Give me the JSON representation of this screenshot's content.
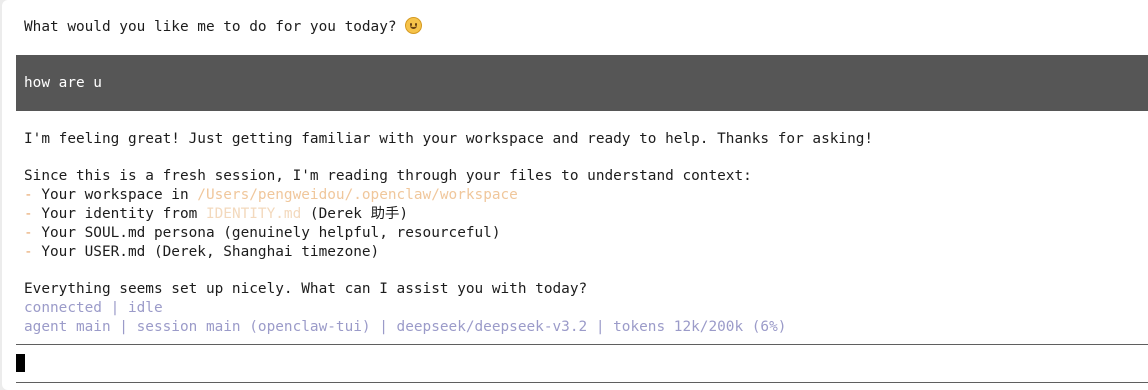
{
  "assistant_prev": {
    "text": "What would you like me to do for you today? "
  },
  "user_message": {
    "text": "how are u"
  },
  "assistant_reply": {
    "line1": "I'm feeling great! Just getting familiar with your workspace and ready to help. Thanks for asking!",
    "line2": "Since this is a fresh session, I'm reading through your files to understand context:",
    "bullet_marker": "- ",
    "bullets": [
      {
        "prefix": "Your workspace in ",
        "highlight": "/Users/pengweidou/.openclaw/workspace",
        "suffix": ""
      },
      {
        "prefix": "Your identity from ",
        "highlight": "IDENTITY.md",
        "suffix": " (Derek 助手)"
      },
      {
        "prefix": "Your SOUL.md persona (genuinely helpful, resourceful)",
        "highlight": "",
        "suffix": ""
      },
      {
        "prefix": "Your USER.md (Derek, Shanghai timezone)",
        "highlight": "",
        "suffix": ""
      }
    ],
    "closing": "Everything seems set up nicely. What can I assist you with today?"
  },
  "status": {
    "connection": "connected | idle",
    "info": "agent main | session main (openclaw-tui) | deepseek/deepseek-v3.2 | tokens 12k/200k (6%)"
  },
  "colors": {
    "user_block_bg": "#565656",
    "status_text": "#9b9bc9",
    "bullet_dash": "#e7a66b",
    "path_highlight": "#f0c79c"
  },
  "icons": {
    "emoji": "smiling-face-icon"
  }
}
